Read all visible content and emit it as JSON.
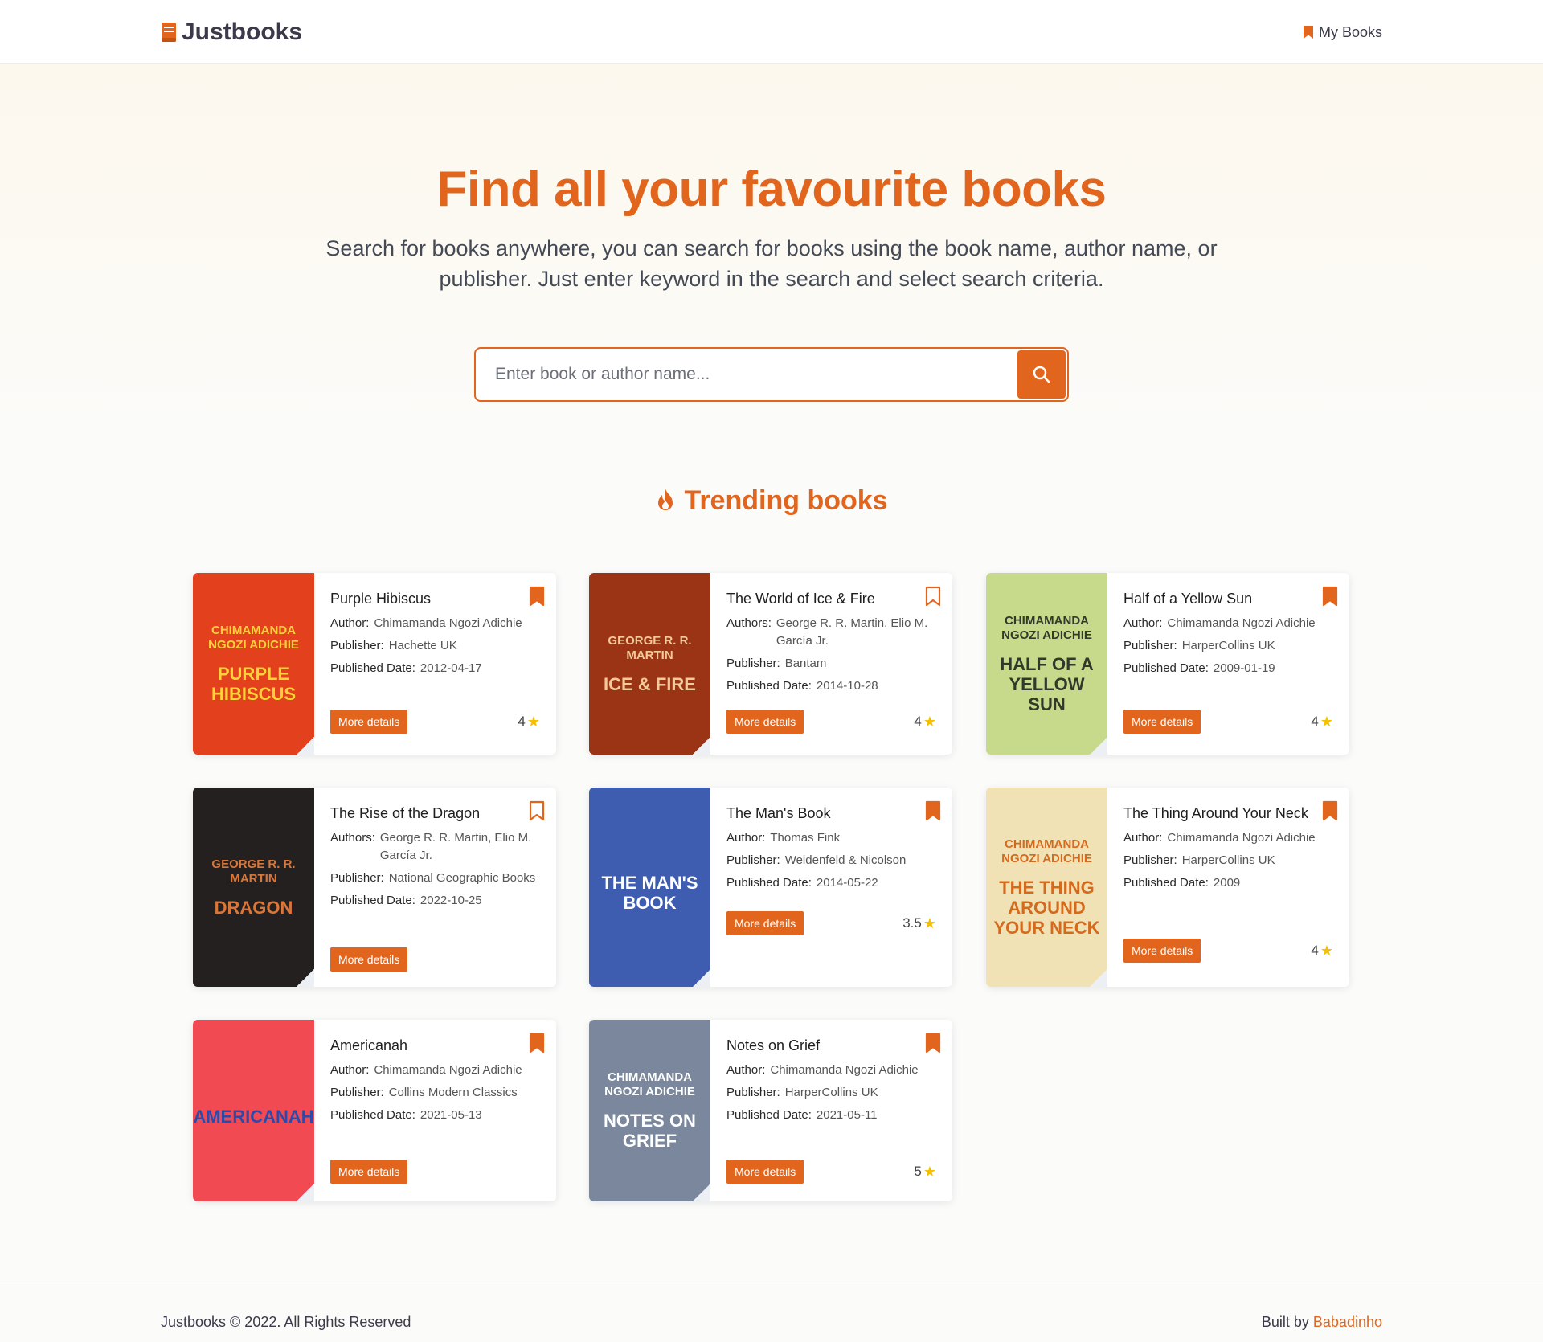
{
  "nav": {
    "brand": "Justbooks",
    "my_books": "My Books"
  },
  "hero": {
    "title": "Find all your favourite books",
    "subtitle": "Search for books anywhere, you can search for books using the book name, author name, or publisher. Just enter keyword in the search and select search criteria.",
    "search_placeholder": "Enter book or author name..."
  },
  "trending": {
    "heading": "Trending books"
  },
  "labels": {
    "author": "Author:",
    "authors": "Authors:",
    "publisher": "Publisher:",
    "published_date": "Published Date:",
    "more_details": "More details"
  },
  "books": [
    {
      "title": "Purple Hibiscus",
      "author_label": "Author:",
      "authors": "Chimamanda Ngozi Adichie",
      "publisher": "Hachette UK",
      "published_date": "2012-04-17",
      "rating": "4",
      "bookmarked": true,
      "cover": {
        "author": "CHIMAMANDA NGOZI ADICHIE",
        "title": "PURPLE HIBISCUS",
        "bg": "#e3401e",
        "fg": "#ffd23a"
      }
    },
    {
      "title": "The World of Ice & Fire",
      "author_label": "Authors:",
      "authors": "George R. R. Martin, Elio M. García Jr.",
      "publisher": "Bantam",
      "published_date": "2014-10-28",
      "rating": "4",
      "bookmarked": false,
      "cover": {
        "author": "GEORGE R. R. MARTIN",
        "title": "ICE & FIRE",
        "bg": "#9a3414",
        "fg": "#f2c99a"
      }
    },
    {
      "title": "Half of a Yellow Sun",
      "author_label": "Author:",
      "authors": "Chimamanda Ngozi Adichie",
      "publisher": "HarperCollins UK",
      "published_date": "2009-01-19",
      "rating": "4",
      "bookmarked": true,
      "cover": {
        "author": "CHIMAMANDA NGOZI ADICHIE",
        "title": "HALF OF A YELLOW SUN",
        "bg": "#c7d98a",
        "fg": "#2f3a2a"
      }
    },
    {
      "title": "The Rise of the Dragon",
      "author_label": "Authors:",
      "authors": "George R. R. Martin, Elio M. García Jr.",
      "publisher": "National Geographic Books",
      "published_date": "2022-10-25",
      "rating": "",
      "bookmarked": false,
      "cover": {
        "author": "GEORGE R. R. MARTIN",
        "title": "DRAGON",
        "bg": "#23201f",
        "fg": "#d9763a"
      }
    },
    {
      "title": "The Man's Book",
      "author_label": "Author:",
      "authors": "Thomas Fink",
      "publisher": "Weidenfeld & Nicolson",
      "published_date": "2014-05-22",
      "rating": "3.5",
      "bookmarked": true,
      "cover": {
        "author": "",
        "title": "THE MAN'S BOOK",
        "bg": "#3f5db0",
        "fg": "#ffffff"
      }
    },
    {
      "title": "The Thing Around Your Neck",
      "author_label": "Author:",
      "authors": "Chimamanda Ngozi Adichie",
      "publisher": "HarperCollins UK",
      "published_date": "2009",
      "rating": "4",
      "bookmarked": true,
      "cover": {
        "author": "CHIMAMANDA NGOZI ADICHIE",
        "title": "THE THING AROUND YOUR NECK",
        "bg": "#f1e2b6",
        "fg": "#d46a1e"
      }
    },
    {
      "title": "Americanah",
      "author_label": "Author:",
      "authors": "Chimamanda Ngozi Adichie",
      "publisher": "Collins Modern Classics",
      "published_date": "2021-05-13",
      "rating": "",
      "bookmarked": true,
      "cover": {
        "author": "",
        "title": "AMERICANAH",
        "bg": "#f24a52",
        "fg": "#2f49a8"
      }
    },
    {
      "title": "Notes on Grief",
      "author_label": "Author:",
      "authors": "Chimamanda Ngozi Adichie",
      "publisher": "HarperCollins UK",
      "published_date": "2021-05-11",
      "rating": "5",
      "bookmarked": true,
      "cover": {
        "author": "CHIMAMANDA NGOZI ADICHIE",
        "title": "NOTES ON GRIEF",
        "bg": "#7a879c",
        "fg": "#ffffff"
      }
    }
  ],
  "footer": {
    "copyright": "Justbooks © 2022. All Rights Reserved",
    "built_by": "Built by",
    "author": "Babadinho"
  },
  "colors": {
    "accent": "#e1651d",
    "star": "#f5c000",
    "text_dark": "#3a3a4a"
  }
}
